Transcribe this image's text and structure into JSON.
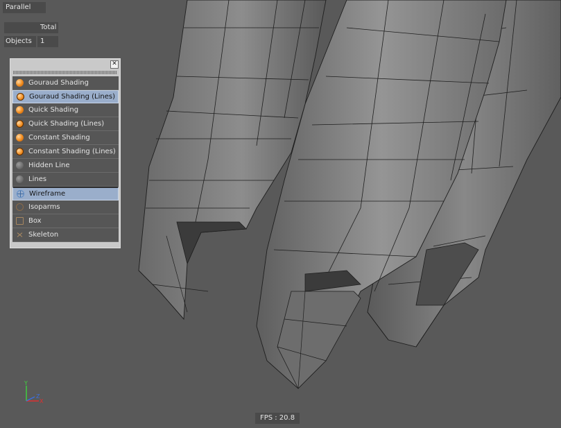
{
  "viewport": {
    "projection_label": "Parallel",
    "stats": {
      "column_header": "Total",
      "row_label": "Objects",
      "row_value": "1"
    },
    "fps_label": "FPS : 20.8",
    "background_color": "#595959"
  },
  "shading_panel": {
    "close_glyph": "✕",
    "items": [
      {
        "label": "Gouraud Shading",
        "icon": "orange-sphere-icon",
        "selected": false
      },
      {
        "label": "Gouraud Shading (Lines)",
        "icon": "orange-sphere-lines-icon",
        "selected": true
      },
      {
        "label": "Quick Shading",
        "icon": "orange-sphere-icon",
        "selected": false
      },
      {
        "label": "Quick Shading (Lines)",
        "icon": "orange-sphere-lines-icon",
        "selected": false
      },
      {
        "label": "Constant Shading",
        "icon": "orange-sphere-icon",
        "selected": false
      },
      {
        "label": "Constant Shading (Lines)",
        "icon": "orange-sphere-lines-icon",
        "selected": false
      },
      {
        "label": "Hidden Line",
        "icon": "gray-sphere-icon",
        "selected": false
      },
      {
        "label": "Lines",
        "icon": "gray-sphere-lines-icon",
        "selected": false
      },
      {
        "label": "Wireframe",
        "icon": "wireframe-sphere-icon",
        "selected": true
      },
      {
        "label": "Isoparms",
        "icon": "isoparm-sphere-icon",
        "selected": false
      },
      {
        "label": "Box",
        "icon": "box-icon",
        "selected": false
      },
      {
        "label": "Skeleton",
        "icon": "skeleton-icon",
        "selected": false
      }
    ],
    "selection_color": "#9aaecb"
  },
  "axis_gizmo": {
    "y_label": "Y",
    "x_label": "X",
    "z_label": "Z",
    "y_color": "#3fd43f",
    "x_color": "#e03030",
    "z_color": "#3a6fe0"
  }
}
